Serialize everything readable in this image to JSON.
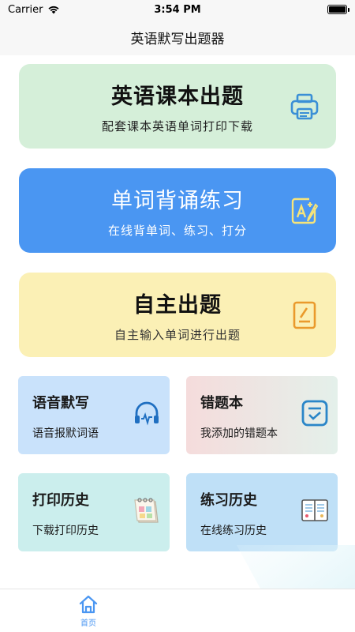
{
  "status_bar": {
    "carrier": "Carrier",
    "time": "3:54 PM"
  },
  "nav": {
    "title": "英语默写出题器"
  },
  "cards": {
    "textbook": {
      "title": "英语课本出题",
      "subtitle": "配套课本英语单词打印下载",
      "icon": "printer-icon"
    },
    "recite": {
      "title": "单词背诵练习",
      "subtitle": "在线背单词、练习、打分",
      "icon": "edit-letter-icon"
    },
    "custom": {
      "title": "自主出题",
      "subtitle": "自主输入单词进行出题",
      "icon": "notepad-icon"
    }
  },
  "tiles": {
    "dictation": {
      "title": "语音默写",
      "subtitle": "语音报默词语",
      "icon": "headphones-icon"
    },
    "mistakes": {
      "title": "错题本",
      "subtitle": "我添加的错题本",
      "icon": "checklist-icon"
    },
    "print_history": {
      "title": "打印历史",
      "subtitle": "下载打印历史",
      "icon": "calendar-icon"
    },
    "practice_history": {
      "title": "练习历史",
      "subtitle": "在线练习历史",
      "icon": "book-icon"
    }
  },
  "tab_bar": {
    "home_label": "首页"
  },
  "colors": {
    "accent_blue": "#4a96f2",
    "card_green": "#d5efd9",
    "card_yellow": "#fbf0b5"
  }
}
